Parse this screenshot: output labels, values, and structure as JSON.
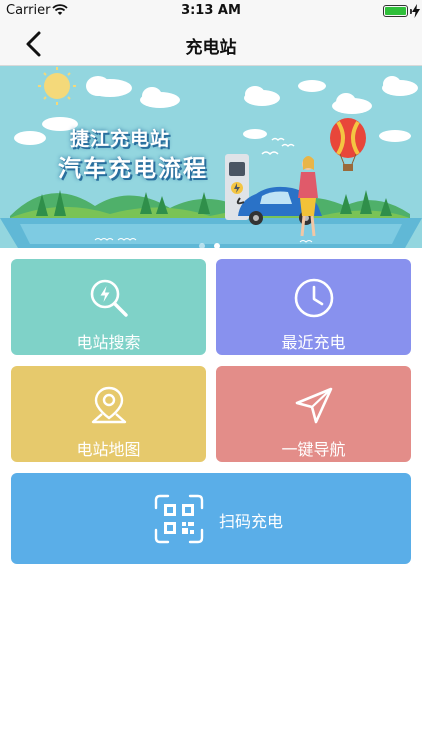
{
  "status_bar": {
    "carrier": "Carrier",
    "time": "3:13 AM",
    "battery_level": 1.0,
    "battery_color": "#2fbf3a"
  },
  "nav": {
    "title": "充电站",
    "back_icon": "chevron-left-icon"
  },
  "banner": {
    "title_line1": "捷江充电站",
    "title_line2": "汽车充电流程",
    "page_count": 2,
    "active_page": 2
  },
  "tiles": {
    "search": {
      "label": "电站搜索",
      "icon": "search-bolt-icon",
      "color": "#7fd2c8"
    },
    "recent": {
      "label": "最近充电",
      "icon": "clock-icon",
      "color": "#8891ee"
    },
    "map": {
      "label": "电站地图",
      "icon": "map-pin-icon",
      "color": "#e6c96c"
    },
    "navigate": {
      "label": "一键导航",
      "icon": "navigation-arrow-icon",
      "color": "#e38d89"
    },
    "scan": {
      "label": "扫码充电",
      "icon": "qr-code-icon",
      "color": "#5aaee8"
    }
  }
}
